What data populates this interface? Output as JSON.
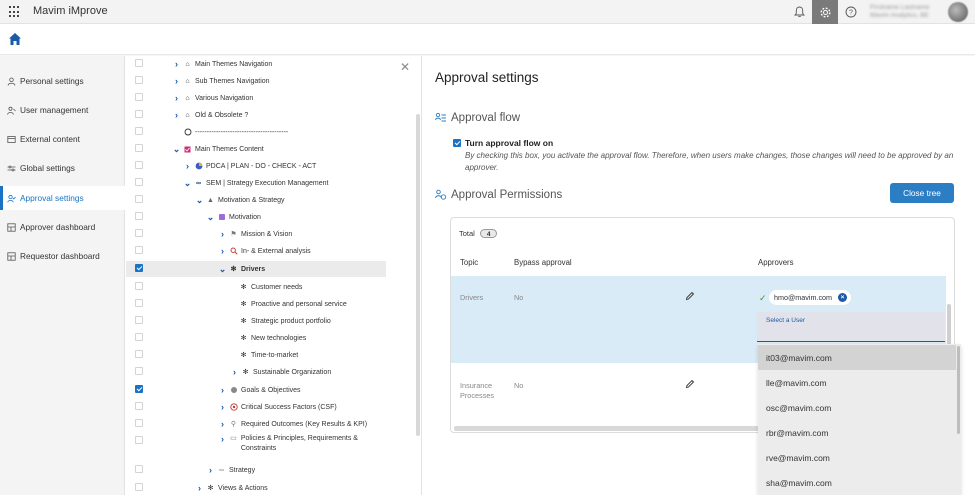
{
  "app": {
    "title": "Mavim iMprove"
  },
  "user": {
    "name": "Firstname Lastname",
    "company": "Mavim Analytics, BE"
  },
  "nav": {
    "items": [
      {
        "label": "Personal settings",
        "icon": "person-icon"
      },
      {
        "label": "User management",
        "icon": "user-management-icon"
      },
      {
        "label": "External content",
        "icon": "external-content-icon"
      },
      {
        "label": "Global settings",
        "icon": "sliders-icon"
      },
      {
        "label": "Approval settings",
        "icon": "approval-icon",
        "active": true
      },
      {
        "label": "Approver dashboard",
        "icon": "dashboard-icon"
      },
      {
        "label": "Requestor dashboard",
        "icon": "dashboard-icon"
      }
    ]
  },
  "tree": {
    "nodes": [
      {
        "label": "Main Themes Navigation"
      },
      {
        "label": "Sub Themes Navigation"
      },
      {
        "label": "Various Navigation"
      },
      {
        "label": "Old & Obsolete ?"
      },
      {
        "label": "----------------------------------------"
      },
      {
        "label": "Main Themes Content"
      },
      {
        "label": "PDCA | PLAN - DO - CHECK - ACT"
      },
      {
        "label": "SEM | Strategy Execution Management"
      },
      {
        "label": "Motivation & Strategy"
      },
      {
        "label": "Motivation"
      },
      {
        "label": "Mission & Vision"
      },
      {
        "label": "In- & External analysis"
      },
      {
        "label": "Drivers"
      },
      {
        "label": "Customer needs"
      },
      {
        "label": "Proactive and personal service"
      },
      {
        "label": "Strategic product portfolio"
      },
      {
        "label": "New technologies"
      },
      {
        "label": "Time-to-market"
      },
      {
        "label": "Sustainable Organization"
      },
      {
        "label": "Goals & Objectives"
      },
      {
        "label": "Critical Success Factors (CSF)"
      },
      {
        "label": "Required Outcomes (Key Results & KPI)"
      },
      {
        "label": "Policies & Principles, Requirements & Constraints"
      },
      {
        "label": "Strategy"
      },
      {
        "label": "Views & Actions"
      }
    ]
  },
  "main": {
    "title": "Approval settings",
    "flow_title": "Approval flow",
    "flow_checkbox_label": "Turn approval flow on",
    "flow_checkbox_checked": true,
    "flow_description": "By checking this box, you activate the approval flow. Therefore, when users make changes, those changes will need to be approved by an approver.",
    "permissions_title": "Approval Permissions",
    "close_tree_label": "Close tree",
    "total_label": "Total",
    "total_count": "4",
    "columns": {
      "topic": "Topic",
      "bypass": "Bypass approval",
      "approvers": "Approvers"
    },
    "rows": [
      {
        "topic": "Drivers",
        "bypass": "No",
        "approver_chip": "hmo@mavim.com",
        "select_placeholder": "Select a User"
      },
      {
        "topic": "Insurance Processes",
        "bypass": "No"
      }
    ],
    "dropdown": [
      "it03@mavim.com",
      "lle@mavim.com",
      "osc@mavim.com",
      "rbr@mavim.com",
      "rve@mavim.com",
      "sha@mavim.com"
    ]
  },
  "colors": {
    "accent": "#1a73c5",
    "button": "#2c7ec4",
    "row_highlight": "#d8ebf6"
  }
}
